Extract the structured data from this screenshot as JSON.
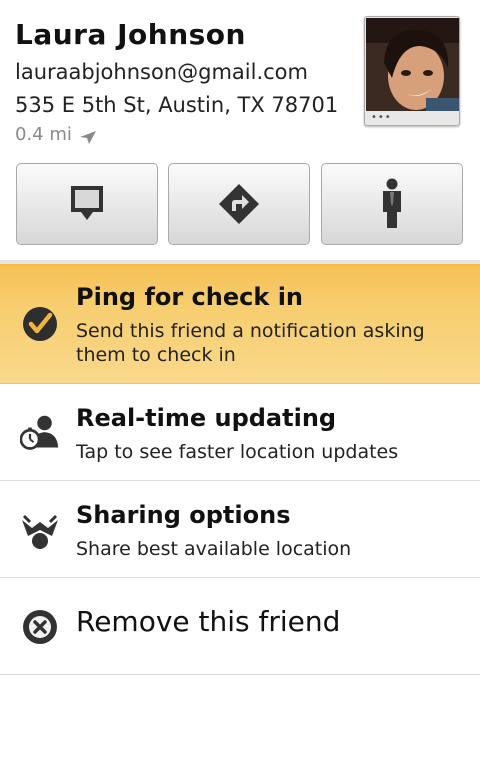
{
  "contact": {
    "name": "Laura Johnson",
    "email": "lauraabjohnson@gmail.com",
    "address": "535 E 5th St, Austin, TX 78701",
    "distance": "0.4 mi",
    "avatar_dots": "•••"
  },
  "actions": [
    {
      "icon": "speech-bubble-icon"
    },
    {
      "icon": "directions-icon"
    },
    {
      "icon": "person-icon"
    }
  ],
  "menu": {
    "ping": {
      "title": "Ping for check in",
      "subtitle": "Send this friend a notification asking them to check in",
      "icon": "checkmark-icon"
    },
    "realtime": {
      "title": "Real-time updating",
      "subtitle": "Tap to see faster location updates",
      "icon": "stopwatch-person-icon"
    },
    "sharing": {
      "title": "Sharing options",
      "subtitle": "Share best available location",
      "icon": "sharing-icon"
    },
    "remove": {
      "label": "Remove this friend",
      "icon": "remove-icon"
    }
  },
  "colors": {
    "highlight": "#f7cd6e",
    "highlight_top": "#f5b93a",
    "icon_dark": "#333333"
  }
}
